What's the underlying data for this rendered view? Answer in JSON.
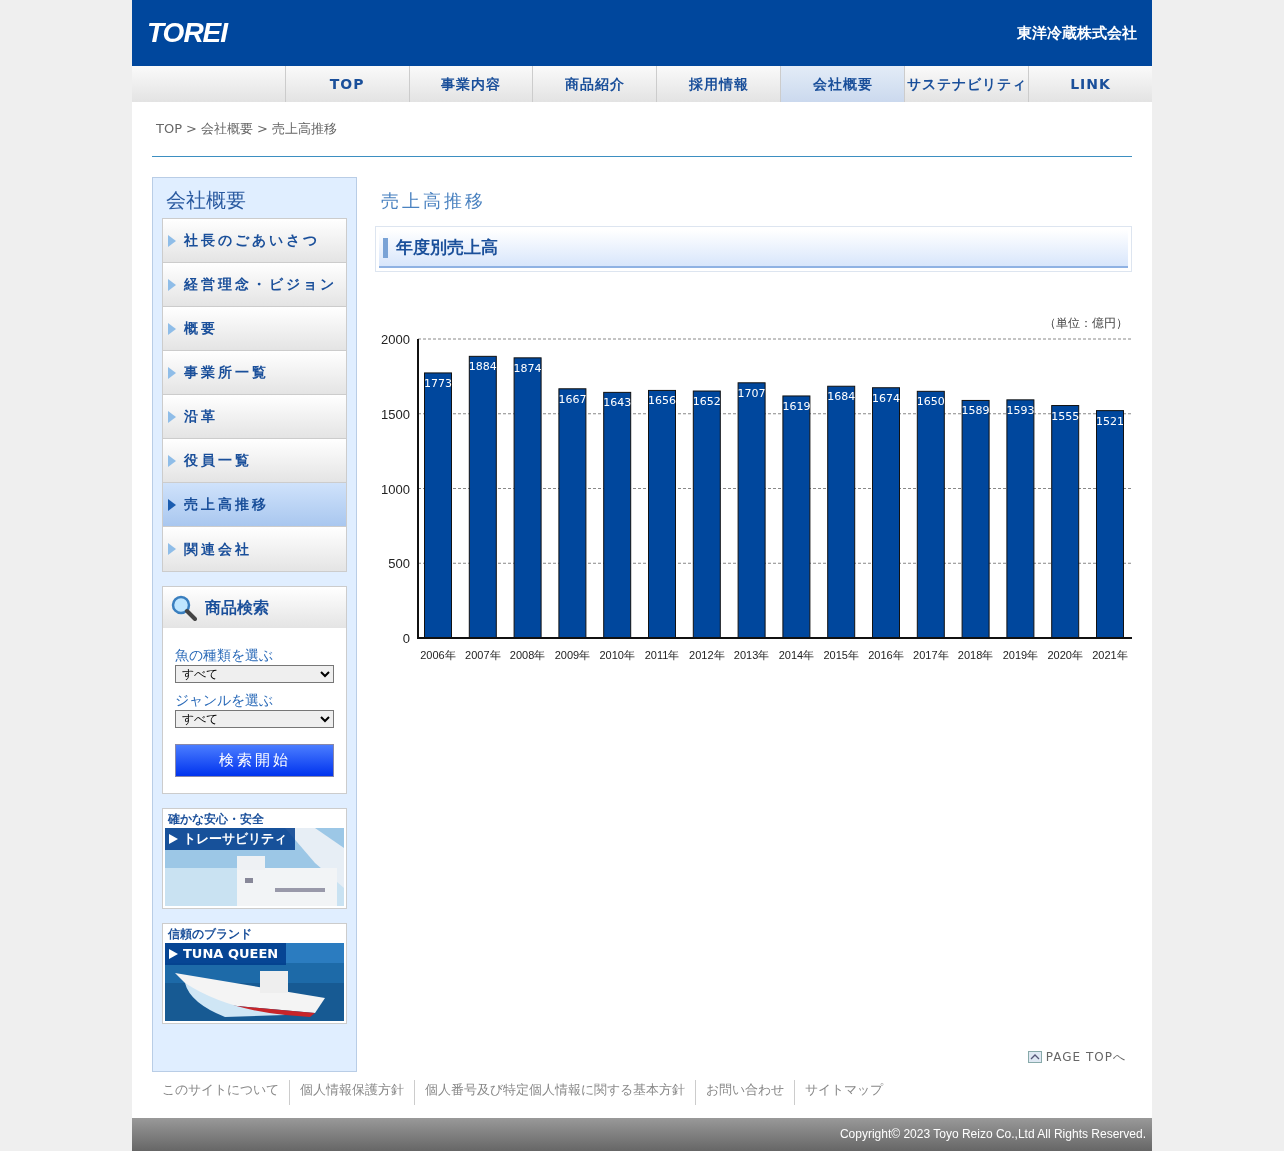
{
  "header": {
    "logo": "TOREI",
    "company": "東洋冷蔵株式会社"
  },
  "nav": [
    {
      "label": "TOP",
      "selected": false
    },
    {
      "label": "事業内容",
      "selected": false
    },
    {
      "label": "商品紹介",
      "selected": false
    },
    {
      "label": "採用情報",
      "selected": false
    },
    {
      "label": "会社概要",
      "selected": true
    },
    {
      "label": "サステナビリティ",
      "selected": false
    },
    {
      "label": "LINK",
      "selected": false
    }
  ],
  "breadcrumb": {
    "separator": ">",
    "items": [
      "TOP",
      "会社概要",
      "売上高推移"
    ]
  },
  "sidebar": {
    "title": "会社概要",
    "items": [
      {
        "label": "社長のごあいさつ",
        "selected": false
      },
      {
        "label": "経営理念・ビジョン",
        "selected": false
      },
      {
        "label": "概要",
        "selected": false
      },
      {
        "label": "事業所一覧",
        "selected": false
      },
      {
        "label": "沿革",
        "selected": false
      },
      {
        "label": "役員一覧",
        "selected": false
      },
      {
        "label": "売上高推移",
        "selected": true
      },
      {
        "label": "関連会社",
        "selected": false
      }
    ],
    "search": {
      "title": "商品検索",
      "fields": [
        {
          "label": "魚の種類を選ぶ",
          "value": "すべて"
        },
        {
          "label": "ジャンルを選ぶ",
          "value": "すべて"
        }
      ],
      "button": "検索開始"
    },
    "banners": [
      {
        "caption": "確かな安心・安全",
        "label": "トレーサビリティ",
        "kind": "picture"
      },
      {
        "caption": "信頼のブランド",
        "label": "TUNA QUEEN",
        "kind": "picture"
      }
    ]
  },
  "main": {
    "title": "売上高推移",
    "section": "年度別売上高",
    "unit": "（単位：億円）",
    "chart_data": {
      "type": "bar",
      "categories": [
        "2006年",
        "2007年",
        "2008年",
        "2009年",
        "2010年",
        "2011年",
        "2012年",
        "2013年",
        "2014年",
        "2015年",
        "2016年",
        "2017年",
        "2018年",
        "2019年",
        "2020年",
        "2021年"
      ],
      "series": [
        {
          "color": "#00479d",
          "values": [
            1773,
            1884,
            1874,
            1667,
            1643,
            1656,
            1652,
            1707,
            1619,
            1684,
            1674,
            1650,
            1589,
            1593,
            1555,
            1521
          ]
        }
      ],
      "ylim": [
        0,
        2000
      ],
      "yticks": [
        0,
        500,
        1000,
        1500,
        2000
      ],
      "data_labels": true,
      "grid": true
    },
    "page_top": "PAGE TOPへ"
  },
  "footer": {
    "links": [
      "このサイトについて",
      "個人情報保護方針",
      "個人番号及び特定個人情報に関する基本方針",
      "お問い合わせ",
      "サイトマップ"
    ],
    "copyright": "Copyright© 2023 Toyo Reizo Co.,Ltd All Rights Reserved."
  }
}
